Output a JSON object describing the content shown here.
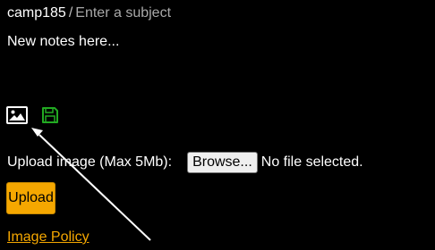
{
  "header": {
    "username": "camp185",
    "separator": "/",
    "subject_placeholder": "Enter a subject"
  },
  "notes": {
    "placeholder": "New notes here..."
  },
  "toolbar": {
    "image_icon": "image-icon",
    "save_icon": "save-icon"
  },
  "upload": {
    "label": "Upload image (Max 5Mb):",
    "browse_label": "Browse...",
    "file_status": "No file selected.",
    "upload_button": "Upload"
  },
  "policy_link": "Image Policy",
  "colors": {
    "background": "#000000",
    "text": "#ffffff",
    "accent": "#f5a700",
    "save_icon": "#22aa22"
  }
}
